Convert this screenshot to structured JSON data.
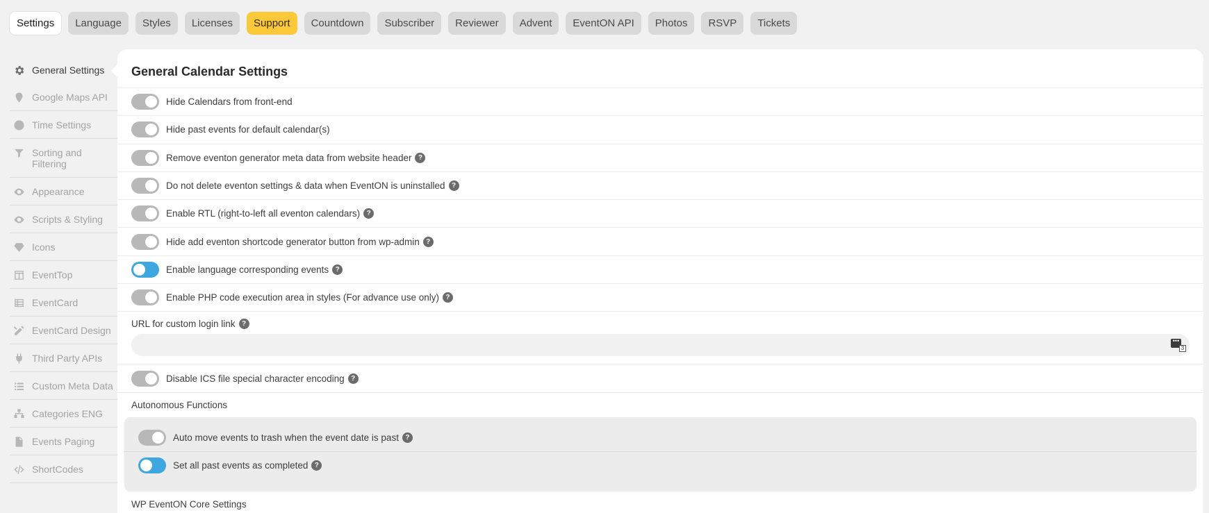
{
  "tabs": [
    {
      "label": "Settings",
      "state": "active"
    },
    {
      "label": "Language",
      "state": ""
    },
    {
      "label": "Styles",
      "state": ""
    },
    {
      "label": "Licenses",
      "state": ""
    },
    {
      "label": "Support",
      "state": "highlight"
    },
    {
      "label": "Countdown",
      "state": ""
    },
    {
      "label": "Subscriber",
      "state": ""
    },
    {
      "label": "Reviewer",
      "state": ""
    },
    {
      "label": "Advent",
      "state": ""
    },
    {
      "label": "EventON API",
      "state": ""
    },
    {
      "label": "Photos",
      "state": ""
    },
    {
      "label": "RSVP",
      "state": ""
    },
    {
      "label": "Tickets",
      "state": ""
    }
  ],
  "sidebar": {
    "items": [
      {
        "label": "General Settings",
        "icon": "gear-icon",
        "active": true
      },
      {
        "label": "Google Maps API",
        "icon": "map-pin-icon"
      },
      {
        "label": "Time Settings",
        "icon": "clock-icon"
      },
      {
        "label": "Sorting and Filtering",
        "icon": "filter-icon"
      },
      {
        "label": "Appearance",
        "icon": "eye-icon"
      },
      {
        "label": "Scripts & Styling",
        "icon": "eye-icon"
      },
      {
        "label": "Icons",
        "icon": "diamond-icon"
      },
      {
        "label": "EventTop",
        "icon": "layout-icon"
      },
      {
        "label": "EventCard",
        "icon": "list-card-icon"
      },
      {
        "label": "EventCard Design",
        "icon": "pencil-ruler-icon"
      },
      {
        "label": "Third Party APIs",
        "icon": "plug-icon"
      },
      {
        "label": "Custom Meta Data",
        "icon": "list-icon"
      },
      {
        "label": "Categories ENG",
        "icon": "sitemap-icon"
      },
      {
        "label": "Events Paging",
        "icon": "file-icon"
      },
      {
        "label": "ShortCodes",
        "icon": "code-icon"
      }
    ]
  },
  "main": {
    "title": "General Calendar Settings",
    "settings": [
      {
        "label": "Hide Calendars from front-end",
        "on": false,
        "help": false
      },
      {
        "label": "Hide past events for default calendar(s)",
        "on": false,
        "help": false
      },
      {
        "label": "Remove eventon generator meta data from website header",
        "on": false,
        "help": true
      },
      {
        "label": "Do not delete eventon settings & data when EventON is uninstalled",
        "on": false,
        "help": true
      },
      {
        "label": "Enable RTL (right-to-left all eventon calendars)",
        "on": false,
        "help": true
      },
      {
        "label": "Hide add eventon shortcode generator button from wp-admin",
        "on": false,
        "help": true
      },
      {
        "label": "Enable language corresponding events",
        "on": true,
        "help": true
      },
      {
        "label": "Enable PHP code execution area in styles (For advance use only)",
        "on": false,
        "help": true
      }
    ],
    "url_field": {
      "label": "URL for custom login link",
      "value": "",
      "placeholder": "",
      "button_badge": "3"
    },
    "ics_setting": {
      "label": "Disable ICS file special character encoding",
      "on": false
    },
    "autonomous": {
      "label": "Autonomous Functions",
      "settings": [
        {
          "label": "Auto move events to trash when the event date is past",
          "on": false
        },
        {
          "label": "Set all past events as completed",
          "on": true
        }
      ]
    },
    "core_label": "WP EventON Core Settings",
    "help_glyph": "?"
  },
  "colors": {
    "accent": "#3ea7e0",
    "support_tab": "#fcc93b",
    "toggle_off": "#b8b8b8"
  }
}
